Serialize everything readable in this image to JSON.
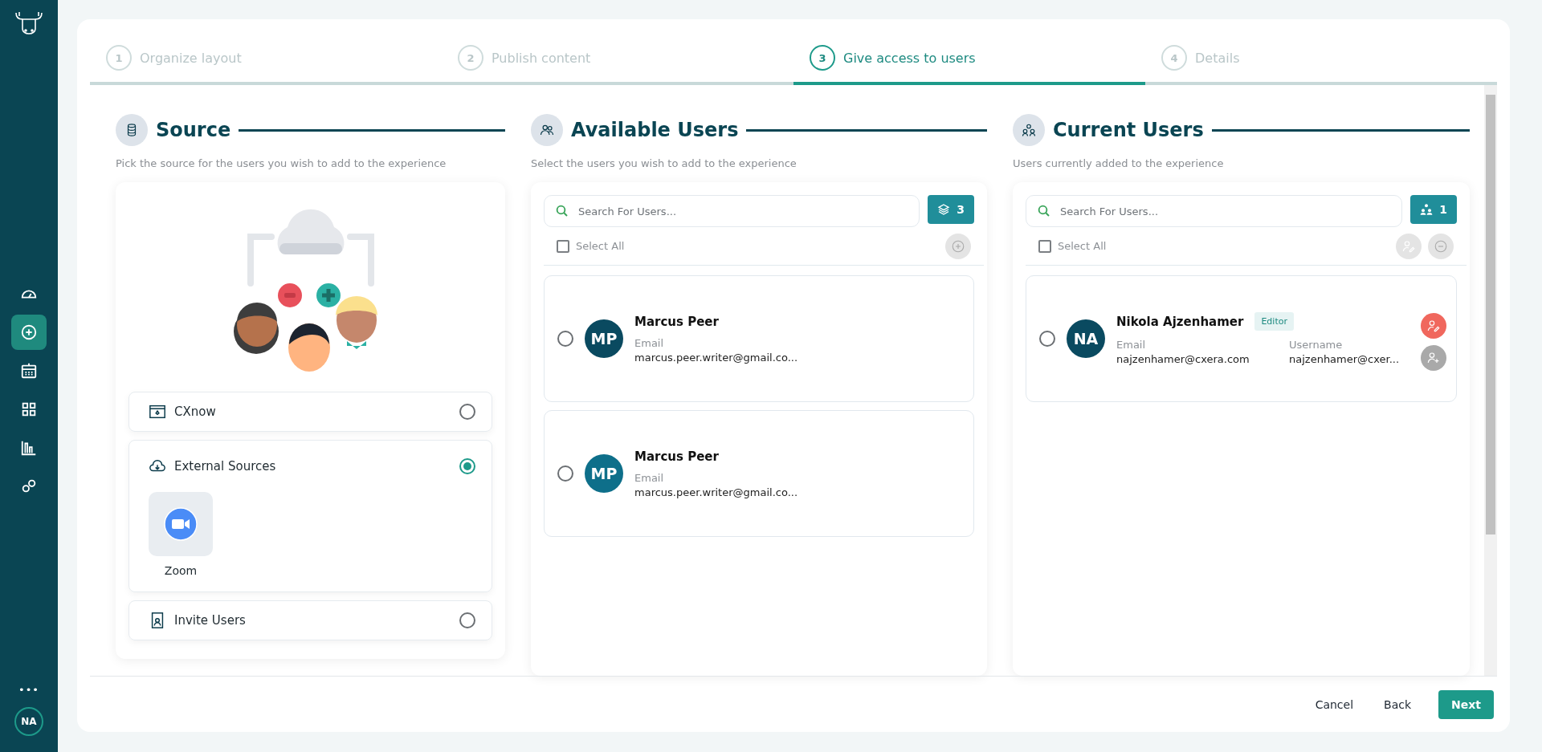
{
  "sidebar": {
    "items": [
      {
        "selected": false
      },
      {
        "selected": true
      },
      {
        "selected": false
      },
      {
        "selected": false
      },
      {
        "selected": false
      },
      {
        "selected": false
      }
    ],
    "more": "•••",
    "user_initials": "NA"
  },
  "stepper": [
    {
      "number": "1",
      "label": "Organize layout",
      "selected": false
    },
    {
      "number": "2",
      "label": "Publish content",
      "selected": false
    },
    {
      "number": "3",
      "label": "Give access to users",
      "selected": true
    },
    {
      "number": "4",
      "label": "Details",
      "selected": false
    }
  ],
  "source": {
    "title": "Source",
    "subtitle": "Pick the source for the users you wish to add to the experience",
    "options": [
      {
        "label": "CXnow",
        "selected": false
      },
      {
        "label": "External Sources",
        "selected": true,
        "integrations": [
          {
            "label": "Zoom"
          }
        ]
      },
      {
        "label": "Invite Users",
        "selected": false
      }
    ]
  },
  "available_users": {
    "title": "Available Users",
    "subtitle": "Select the users you wish to add to the experience",
    "search": {
      "placeholder": "Search For Users..."
    },
    "count": "3",
    "select_all": {
      "label": "Select All",
      "checked": false
    },
    "users": [
      {
        "initials": "MP",
        "color": "#0a4a60",
        "name": "Marcus Peer",
        "selected": false,
        "fields": [
          {
            "label": "Email",
            "value": "marcus.peer.writer@gmail.co..."
          }
        ]
      },
      {
        "initials": "MP",
        "color": "#0e6f8a",
        "name": "Marcus Peer",
        "selected": false,
        "fields": [
          {
            "label": "Email",
            "value": "marcus.peer.writer@gmail.co..."
          }
        ]
      }
    ]
  },
  "current_users": {
    "title": "Current Users",
    "subtitle": "Users currently added to the experience",
    "search": {
      "placeholder": "Search For Users..."
    },
    "count": "1",
    "select_all": {
      "label": "Select All",
      "checked": false
    },
    "users": [
      {
        "initials": "NA",
        "color": "#0a4a60",
        "name": "Nikola Ajzenhamer",
        "role": "Editor",
        "selected": false,
        "fields": [
          {
            "label": "Email",
            "value": "najzenhamer@cxera.com"
          },
          {
            "label": "Username",
            "value": "najzenhamer@cxer..."
          }
        ]
      }
    ]
  },
  "footer": {
    "buttons": [
      {
        "label": "Cancel",
        "kind": "text"
      },
      {
        "label": "Back",
        "kind": "text"
      },
      {
        "label": "Next",
        "kind": "primary"
      }
    ]
  }
}
